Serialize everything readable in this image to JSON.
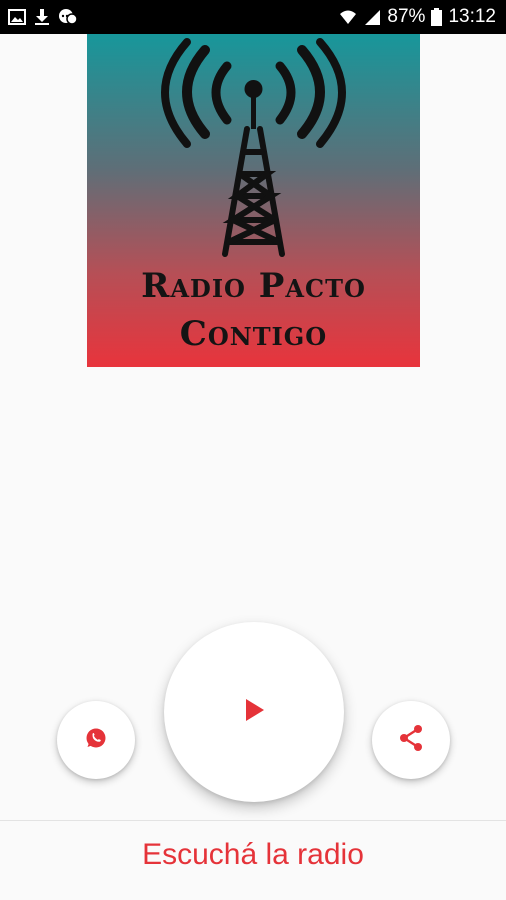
{
  "status_bar": {
    "battery_percent": "87%",
    "time": "13:12",
    "icons": [
      "image-icon",
      "download-icon",
      "chat-icon",
      "wifi-icon",
      "signal-icon",
      "battery-icon"
    ]
  },
  "logo": {
    "line1": "Radio Pacto",
    "line2": "Contigo"
  },
  "controls": {
    "whatsapp_icon": "whatsapp-icon",
    "play_icon": "play-icon",
    "share_icon": "share-icon"
  },
  "footer": {
    "label": "Escuchá la radio"
  },
  "colors": {
    "accent": "#e53339",
    "statusbar": "#000000",
    "background": "#fafafa"
  }
}
